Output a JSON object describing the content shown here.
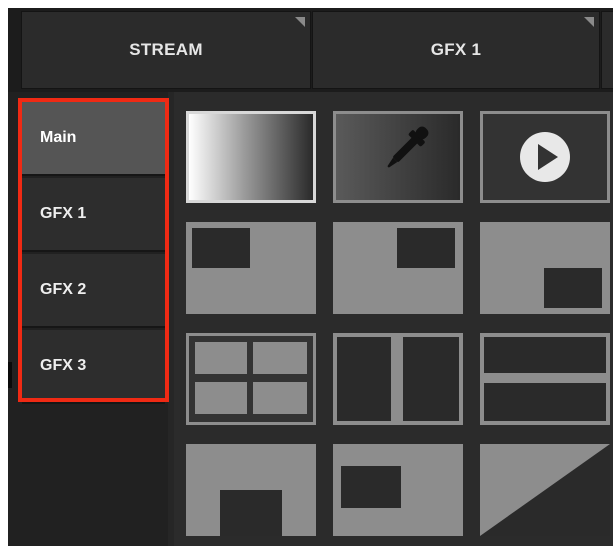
{
  "tabs": [
    {
      "label": "STREAM"
    },
    {
      "label": "GFX 1"
    }
  ],
  "scenes": [
    {
      "label": "Main",
      "active": true
    },
    {
      "label": "GFX 1",
      "active": false
    },
    {
      "label": "GFX 2",
      "active": false
    },
    {
      "label": "GFX 3",
      "active": false
    }
  ],
  "highlight_color": "#f02a14",
  "tiles": [
    {
      "name": "gradient-transition-tile"
    },
    {
      "name": "color-picker-tile",
      "icon": "eyedropper-icon"
    },
    {
      "name": "play-media-tile",
      "icon": "play-icon"
    },
    {
      "name": "layout-top-left-tile"
    },
    {
      "name": "layout-top-right-tile"
    },
    {
      "name": "layout-bottom-right-tile"
    },
    {
      "name": "layout-quad-grid-tile"
    },
    {
      "name": "layout-two-columns-tile"
    },
    {
      "name": "layout-two-rows-tile"
    },
    {
      "name": "layout-bottom-center-tile"
    },
    {
      "name": "layout-center-left-tile"
    },
    {
      "name": "layout-diagonal-tile"
    }
  ]
}
